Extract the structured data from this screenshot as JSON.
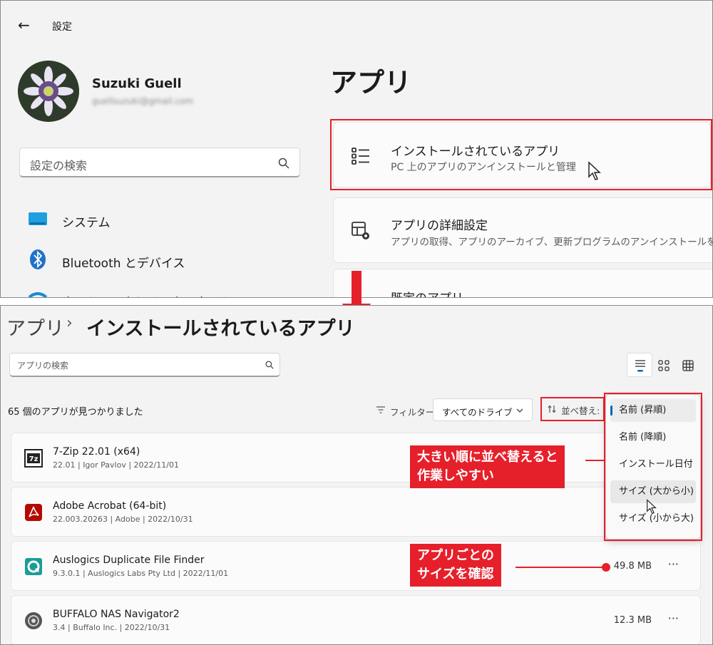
{
  "top_window": {
    "back_label": "←",
    "title": "設定",
    "user": {
      "name": "Suzuki Guell",
      "email": "guellsuzuki@gmail.com"
    },
    "search": {
      "placeholder": "設定の検索"
    },
    "nav": [
      {
        "label": "システム",
        "icon": "monitor-icon"
      },
      {
        "label": "Bluetooth とデバイス",
        "icon": "bluetooth-icon"
      },
      {
        "label": "ネットワークとインターネット",
        "icon": "wifi-icon"
      }
    ],
    "page_title": "アプリ",
    "cards": [
      {
        "title": "インストールされているアプリ",
        "subtitle": "PC 上のアプリのアンインストールと管理",
        "icon": "list-icon"
      },
      {
        "title": "アプリの詳細設定",
        "subtitle": "アプリの取得、アプリのアーカイブ、更新プログラムのアンインストールを行",
        "icon": "app-settings-icon"
      },
      {
        "title": "既定のアプリ",
        "subtitle": "",
        "icon": "default-apps-icon"
      }
    ]
  },
  "bottom_window": {
    "breadcrumb": {
      "parent": "アプリ",
      "separator": "›",
      "current": "インストールされているアプリ"
    },
    "search": {
      "placeholder": "アプリの検索"
    },
    "view_buttons": [
      "list-view-icon",
      "tile-view-icon",
      "grid-view-icon"
    ],
    "count_text": "65 個のアプリが見つかりました",
    "filter": {
      "label": "フィルター:",
      "value": "すべてのドライブ"
    },
    "sort": {
      "label": "並べ替え:"
    },
    "sort_menu": [
      "名前 (昇順)",
      "名前 (降順)",
      "インストール日付",
      "サイズ (大から小)",
      "サイズ (小から大)"
    ],
    "apps": [
      {
        "name": "7-Zip 22.01 (x64)",
        "meta": "22.01  |  Igor Pavlov  |  2022/11/01",
        "size": "",
        "icon": "seven-zip-icon"
      },
      {
        "name": "Adobe Acrobat (64-bit)",
        "meta": "22.003.20263  |  Adobe  |  2022/10/31",
        "size": "",
        "icon": "acrobat-icon"
      },
      {
        "name": "Auslogics Duplicate File Finder",
        "meta": "9.3.0.1  |  Auslogics Labs Pty Ltd  |  2022/11/01",
        "size": "49.8 MB",
        "icon": "auslogics-icon"
      },
      {
        "name": "BUFFALO NAS Navigator2",
        "meta": "3.4  |  Buffalo Inc.  |  2022/10/31",
        "size": "12.3 MB",
        "icon": "buffalo-icon"
      }
    ],
    "more_label": "···"
  },
  "callouts": {
    "sort_tip_line1": "大きい順に並べ替えると",
    "sort_tip_line2": "作業しやすい",
    "size_tip_line1": "アプリごとの",
    "size_tip_line2": "サイズを確認"
  },
  "colors": {
    "accent": "#e6202b",
    "windows_blue": "#0067c0"
  }
}
